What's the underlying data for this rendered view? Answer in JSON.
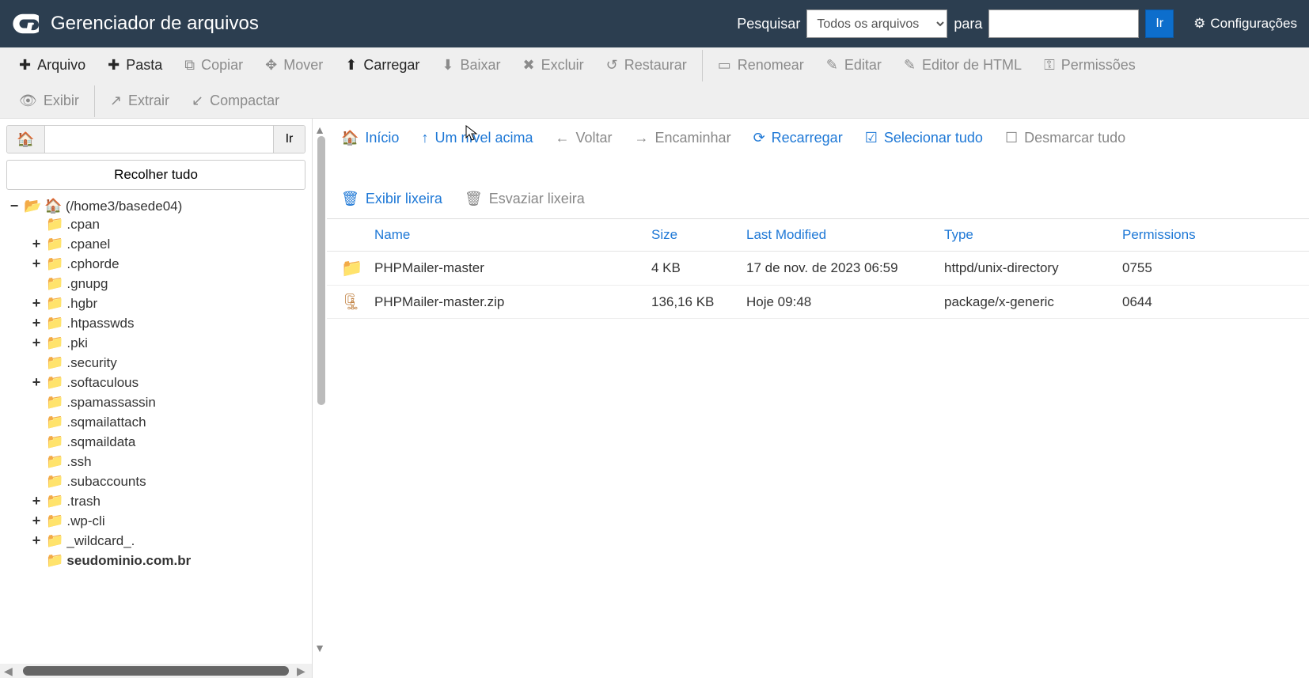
{
  "header": {
    "title": "Gerenciador de arquivos",
    "search_label": "Pesquisar",
    "search_scope": "Todos os arquivos",
    "for_label": "para",
    "go_label": "Ir",
    "settings_label": "Configurações"
  },
  "toolbar": {
    "file": "Arquivo",
    "folder": "Pasta",
    "copy": "Copiar",
    "move": "Mover",
    "upload": "Carregar",
    "download": "Baixar",
    "delete": "Excluir",
    "restore": "Restaurar",
    "rename": "Renomear",
    "edit": "Editar",
    "html_editor": "Editor de HTML",
    "permissions": "Permissões",
    "view": "Exibir",
    "extract": "Extrair",
    "compress": "Compactar"
  },
  "sidebar": {
    "go_label": "Ir",
    "collapse_label": "Recolher tudo",
    "root_label": "(/home3/basede04)",
    "items": [
      {
        "label": ".cpan",
        "exp": ""
      },
      {
        "label": ".cpanel",
        "exp": "+"
      },
      {
        "label": ".cphorde",
        "exp": "+"
      },
      {
        "label": ".gnupg",
        "exp": ""
      },
      {
        "label": ".hgbr",
        "exp": "+"
      },
      {
        "label": ".htpasswds",
        "exp": "+"
      },
      {
        "label": ".pki",
        "exp": "+"
      },
      {
        "label": ".security",
        "exp": ""
      },
      {
        "label": ".softaculous",
        "exp": "+"
      },
      {
        "label": ".spamassassin",
        "exp": ""
      },
      {
        "label": ".sqmailattach",
        "exp": ""
      },
      {
        "label": ".sqmaildata",
        "exp": ""
      },
      {
        "label": ".ssh",
        "exp": ""
      },
      {
        "label": ".subaccounts",
        "exp": ""
      },
      {
        "label": ".trash",
        "exp": "+"
      },
      {
        "label": ".wp-cli",
        "exp": "+"
      },
      {
        "label": "_wildcard_.",
        "exp": "+"
      },
      {
        "label": "seudominio.com.br",
        "exp": "",
        "bold": true
      }
    ]
  },
  "actionbar": {
    "home": "Início",
    "up": "Um nível acima",
    "back": "Voltar",
    "forward": "Encaminhar",
    "reload": "Recarregar",
    "select_all": "Selecionar tudo",
    "unselect_all": "Desmarcar tudo",
    "show_trash": "Exibir lixeira",
    "empty_trash": "Esvaziar lixeira"
  },
  "columns": {
    "name": "Name",
    "size": "Size",
    "modified": "Last Modified",
    "type": "Type",
    "permissions": "Permissions"
  },
  "rows": [
    {
      "icon": "folder",
      "name": "PHPMailer-master",
      "size": "4 KB",
      "modified": "17 de nov. de 2023 06:59",
      "type": "httpd/unix-directory",
      "perm": "0755"
    },
    {
      "icon": "zip",
      "name": "PHPMailer-master.zip",
      "size": "136,16 KB",
      "modified": "Hoje 09:48",
      "type": "package/x-generic",
      "perm": "0644"
    }
  ]
}
